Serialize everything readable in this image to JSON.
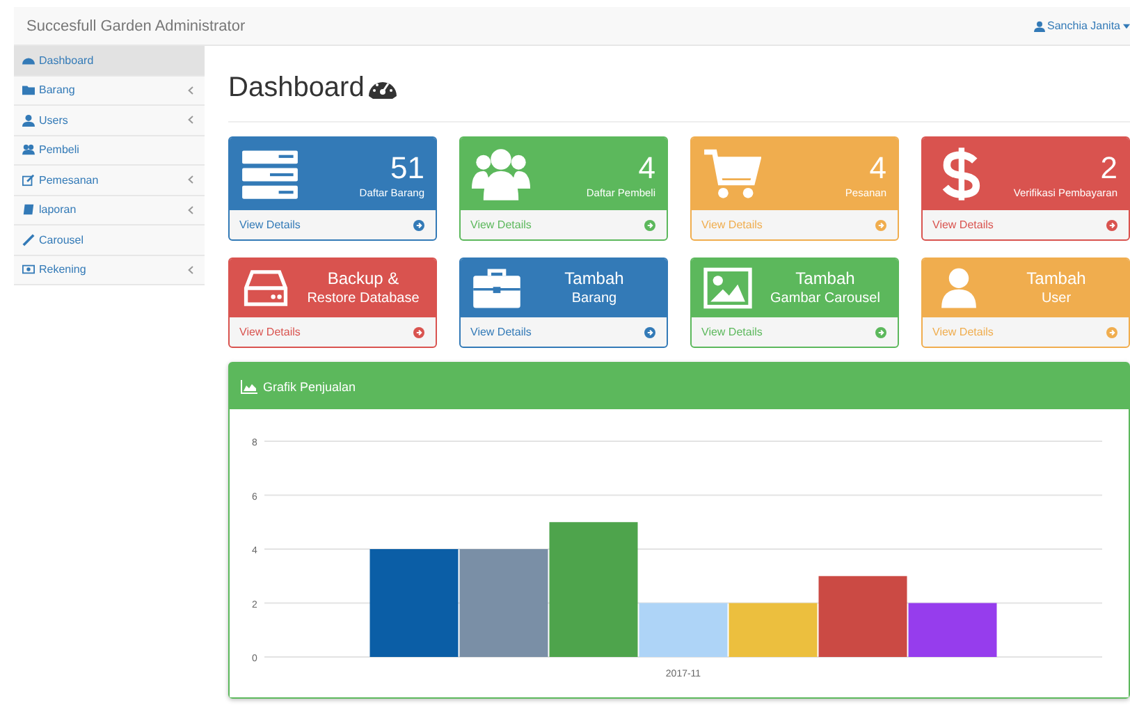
{
  "navbar": {
    "brand": "Succesfull Garden Administrator",
    "user": "Sanchia Janita"
  },
  "sidebar": {
    "items": [
      {
        "label": "Dashboard",
        "selected": true,
        "caret": false
      },
      {
        "label": "Barang",
        "selected": false,
        "caret": true
      },
      {
        "label": "Users",
        "selected": false,
        "caret": true
      },
      {
        "label": "Pembeli",
        "selected": false,
        "caret": false
      },
      {
        "label": "Pemesanan",
        "selected": false,
        "caret": true
      },
      {
        "label": "laporan",
        "selected": false,
        "caret": true
      },
      {
        "label": "Carousel",
        "selected": false,
        "caret": false
      },
      {
        "label": "Rekening",
        "selected": false,
        "caret": true
      }
    ]
  },
  "page_title": "Dashboard",
  "cards": [
    {
      "kind": "count",
      "color": "#337ab7",
      "number": "51",
      "label": "Daftar Barang",
      "link": "View Details"
    },
    {
      "kind": "count",
      "color": "#5cb85c",
      "number": "4",
      "label": "Daftar Pembeli",
      "link": "View Details"
    },
    {
      "kind": "count",
      "color": "#f0ad4e",
      "number": "4",
      "label": "Pesanan",
      "link": "View Details"
    },
    {
      "kind": "count",
      "color": "#d9534f",
      "number": "2",
      "label": "Verifikasi Pembayaran",
      "link": "View Details"
    },
    {
      "kind": "action",
      "color": "#d9534f",
      "title": "Backup &",
      "subtitle": "Restore Database",
      "link": "View Details"
    },
    {
      "kind": "action",
      "color": "#337ab7",
      "title": "Tambah",
      "subtitle": "Barang",
      "link": "View Details"
    },
    {
      "kind": "action",
      "color": "#5cb85c",
      "title": "Tambah",
      "subtitle": "Gambar Carousel",
      "link": "View Details"
    },
    {
      "kind": "action",
      "color": "#f0ad4e",
      "title": "Tambah",
      "subtitle": "User",
      "link": "View Details"
    }
  ],
  "chart_panel": {
    "title": "Grafik Penjualan",
    "chart_data": {
      "type": "bar",
      "categories": [
        "2017-11"
      ],
      "series": [
        {
          "color": "#0b5ea6",
          "values": [
            4
          ]
        },
        {
          "color": "#7a8fa6",
          "values": [
            4
          ]
        },
        {
          "color": "#4ea44c",
          "values": [
            5
          ]
        },
        {
          "color": "#aed4f7",
          "values": [
            2
          ]
        },
        {
          "color": "#ecbf3e",
          "values": [
            2
          ]
        },
        {
          "color": "#cb4a44",
          "values": [
            3
          ]
        },
        {
          "color": "#963ded",
          "values": [
            2
          ]
        }
      ],
      "ylim": [
        0,
        8
      ],
      "grid": true,
      "yticks": [
        0,
        2,
        4,
        6,
        8
      ]
    }
  }
}
